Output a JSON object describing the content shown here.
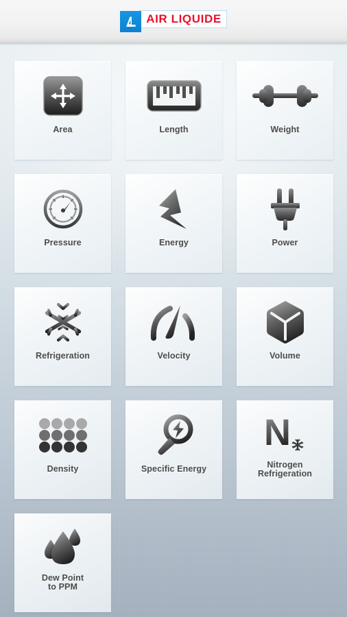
{
  "header": {
    "logo_mark_alt": "AL",
    "logo_text": "AIR LIQUIDE",
    "logo_red": "#e8112d",
    "logo_blue": "#0b82d2"
  },
  "grid": {
    "tiles": [
      {
        "label": "Area",
        "icon": "move-arrows-icon"
      },
      {
        "label": "Length",
        "icon": "ruler-icon"
      },
      {
        "label": "Weight",
        "icon": "dumbbell-icon"
      },
      {
        "label": "Pressure",
        "icon": "gauge-icon"
      },
      {
        "label": "Energy",
        "icon": "lightning-bolt-icon"
      },
      {
        "label": "Power",
        "icon": "power-plug-icon"
      },
      {
        "label": "Refrigeration",
        "icon": "snowflake-icon"
      },
      {
        "label": "Velocity",
        "icon": "speedometer-icon"
      },
      {
        "label": "Volume",
        "icon": "cube-icon"
      },
      {
        "label": "Density",
        "icon": "dot-grid-icon"
      },
      {
        "label": "Specific Energy",
        "icon": "magnifier-bolt-icon"
      },
      {
        "label": "Nitrogen\nRefrigeration",
        "icon": "nitrogen-snowflake-icon"
      },
      {
        "label": "Dew Point\nto PPM",
        "icon": "water-droplets-icon"
      }
    ]
  },
  "theme": {
    "tile_background": "#eef3f6",
    "label_color": "#4a4a4a",
    "background_top": "#dfe9ee",
    "background_bottom": "#a4b1be"
  }
}
